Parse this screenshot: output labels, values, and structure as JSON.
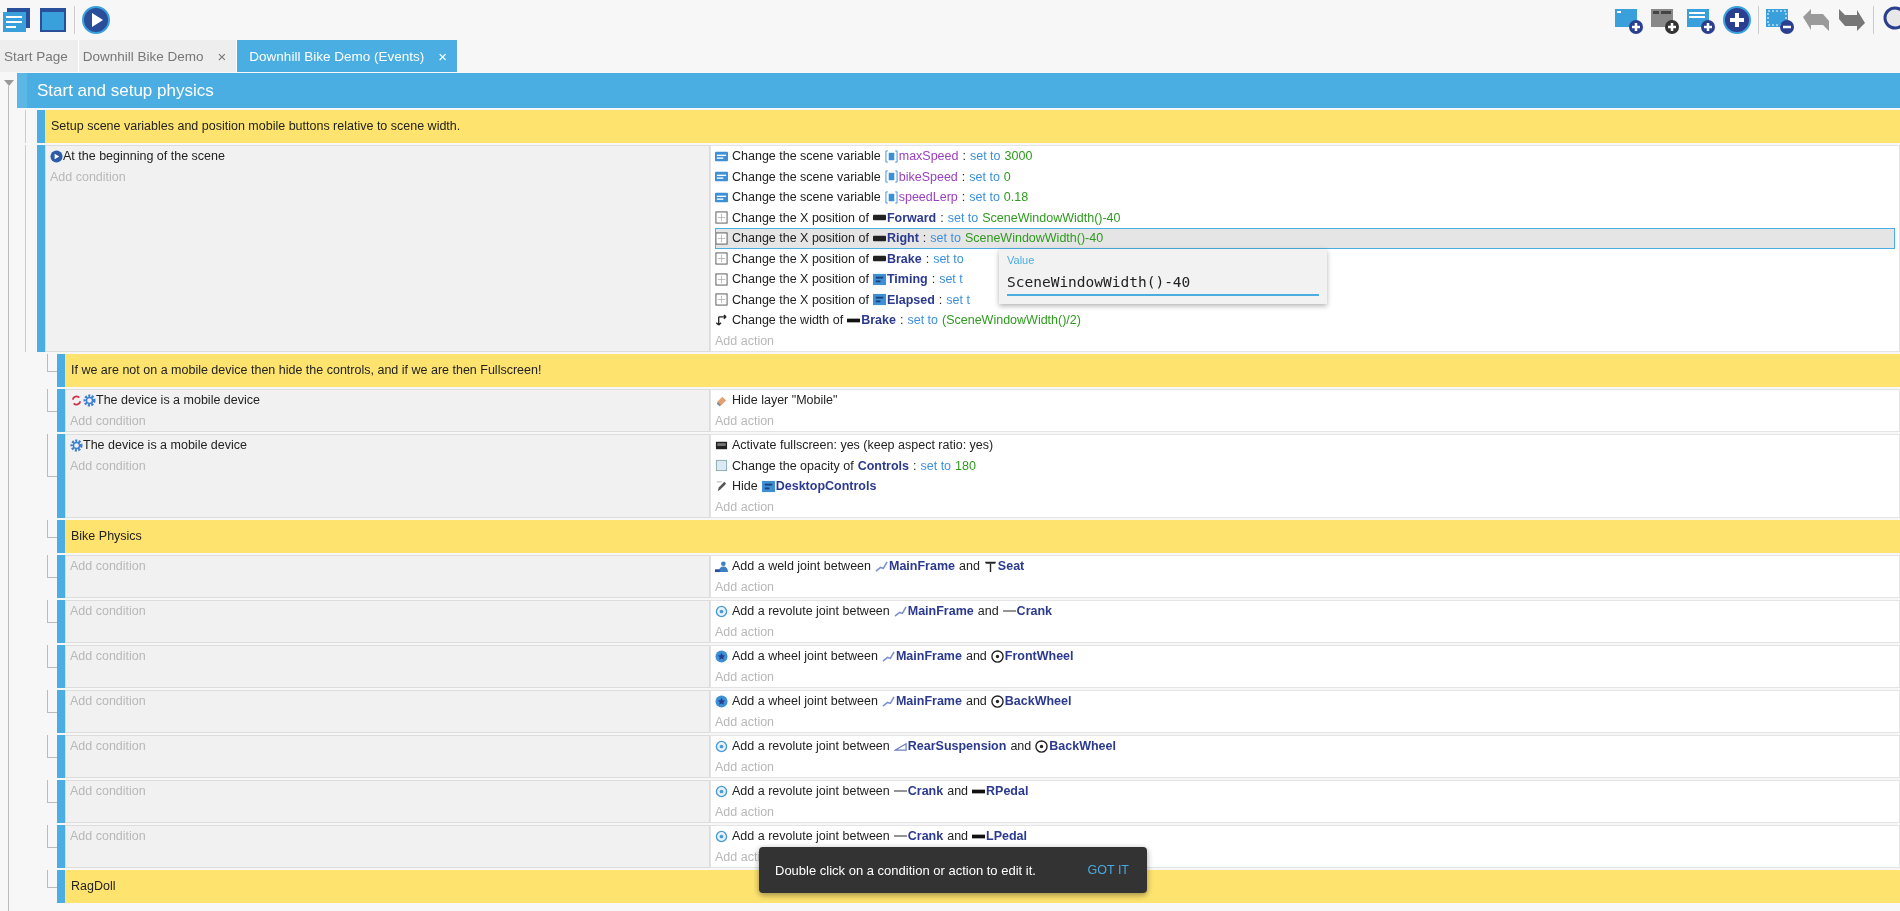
{
  "tabs": [
    {
      "label": "Start Page",
      "selected": false
    },
    {
      "label": "Downhill Bike Demo",
      "selected": false,
      "close": "×"
    },
    {
      "label": "Downhill Bike Demo (Events)",
      "selected": true,
      "close": "×"
    }
  ],
  "group": {
    "title": "Start and setup physics",
    "items": [
      {
        "kind": "comment",
        "text": "Setup scene variables and position mobile buttons relative to scene width."
      },
      {
        "kind": "event",
        "conditions": [
          {
            "kind": "scene-start",
            "inverted": false,
            "text": "At the beginning of the scene"
          }
        ],
        "add_condition": "Add condition",
        "add_action": "Add action",
        "actions": [
          {
            "kind": "variable",
            "selected": false,
            "parts": [
              {
                "kind": "text",
                "text": "Change the scene variable"
              },
              {
                "kind": "var",
                "text": "maxSpeed"
              },
              {
                "kind": "text",
                "text": ":"
              },
              {
                "kind": "op",
                "text": "set to"
              },
              {
                "kind": "value",
                "text": "3000"
              }
            ]
          },
          {
            "kind": "variable",
            "selected": false,
            "parts": [
              {
                "kind": "text",
                "text": "Change the scene variable"
              },
              {
                "kind": "var",
                "text": "bikeSpeed"
              },
              {
                "kind": "text",
                "text": ":"
              },
              {
                "kind": "op",
                "text": "set to"
              },
              {
                "kind": "value",
                "text": "0"
              }
            ]
          },
          {
            "kind": "variable",
            "selected": false,
            "parts": [
              {
                "kind": "text",
                "text": "Change the scene variable"
              },
              {
                "kind": "var",
                "text": "speedLerp"
              },
              {
                "kind": "text",
                "text": ":"
              },
              {
                "kind": "op",
                "text": "set to"
              },
              {
                "kind": "value",
                "text": "0.18"
              }
            ]
          },
          {
            "kind": "position",
            "selected": false,
            "parts": [
              {
                "kind": "text",
                "text": "Change the X position of"
              },
              {
                "kind": "button",
                "text": "Forward"
              },
              {
                "kind": "text",
                "text": ":"
              },
              {
                "kind": "op",
                "text": "set to"
              },
              {
                "kind": "value",
                "text": "SceneWindowWidth()-40"
              }
            ]
          },
          {
            "kind": "position",
            "selected": true,
            "parts": [
              {
                "kind": "text",
                "text": "Change the X position of"
              },
              {
                "kind": "button",
                "text": "Right"
              },
              {
                "kind": "text",
                "text": ":"
              },
              {
                "kind": "op",
                "text": "set to"
              },
              {
                "kind": "value",
                "text": "SceneWindowWidth()-40"
              }
            ],
            "editor": {
              "label": "Value",
              "value": "SceneWindowWidth()-40"
            }
          },
          {
            "kind": "position",
            "selected": false,
            "parts": [
              {
                "kind": "text",
                "text": "Change the X position of"
              },
              {
                "kind": "button",
                "text": "Brake"
              },
              {
                "kind": "text",
                "text": ":"
              },
              {
                "kind": "op",
                "text": "set to"
              }
            ]
          },
          {
            "kind": "position",
            "selected": false,
            "parts": [
              {
                "kind": "text",
                "text": "Change the X position of"
              },
              {
                "kind": "textobject",
                "text": "Timing"
              },
              {
                "kind": "text",
                "text": ":"
              },
              {
                "kind": "op",
                "text": "set t"
              }
            ]
          },
          {
            "kind": "position",
            "selected": false,
            "parts": [
              {
                "kind": "text",
                "text": "Change the X position of"
              },
              {
                "kind": "textobject",
                "text": "Elapsed"
              },
              {
                "kind": "text",
                "text": ":"
              },
              {
                "kind": "op",
                "text": "set t"
              }
            ]
          },
          {
            "kind": "width",
            "selected": false,
            "parts": [
              {
                "kind": "text",
                "text": "Change the width of"
              },
              {
                "kind": "pedal",
                "text": "Brake"
              },
              {
                "kind": "text",
                "text": ":"
              },
              {
                "kind": "op",
                "text": "set to"
              },
              {
                "kind": "value",
                "text": "(SceneWindowWidth()/2)"
              }
            ]
          }
        ],
        "children": [
          {
            "kind": "comment",
            "text": "If we are not on a mobile device then hide the controls, and if we are then Fullscreen!"
          },
          {
            "kind": "event",
            "conditions": [
              {
                "kind": "device",
                "inverted": true,
                "text": "The device is a mobile device"
              }
            ],
            "add_condition": "Add condition",
            "add_action": "Add action",
            "actions": [
              {
                "kind": "layer",
                "selected": false,
                "parts": [
                  {
                    "kind": "text",
                    "text": "Hide layer \"Mobile\""
                  }
                ]
              }
            ]
          },
          {
            "kind": "event",
            "conditions": [
              {
                "kind": "device",
                "inverted": false,
                "text": "The device is a mobile device"
              }
            ],
            "add_condition": "Add condition",
            "add_action": "Add action",
            "actions": [
              {
                "kind": "fullscreen",
                "selected": false,
                "parts": [
                  {
                    "kind": "text",
                    "text": "Activate fullscreen: yes (keep aspect ratio: yes)"
                  }
                ]
              },
              {
                "kind": "opacity",
                "selected": false,
                "parts": [
                  {
                    "kind": "text",
                    "text": "Change the opacity of"
                  },
                  {
                    "kind": "object",
                    "text": "Controls"
                  },
                  {
                    "kind": "text",
                    "text": ":"
                  },
                  {
                    "kind": "op",
                    "text": "set to"
                  },
                  {
                    "kind": "value",
                    "text": "180"
                  }
                ]
              },
              {
                "kind": "visibility",
                "selected": false,
                "parts": [
                  {
                    "kind": "text",
                    "text": "Hide"
                  },
                  {
                    "kind": "textobject",
                    "text": "DesktopControls"
                  }
                ]
              }
            ]
          },
          {
            "kind": "comment",
            "text": "Bike Physics"
          },
          {
            "kind": "event",
            "add_condition": "Add condition",
            "add_action": "Add action",
            "actions": [
              {
                "kind": "weld",
                "selected": false,
                "parts": [
                  {
                    "kind": "text",
                    "text": "Add a weld joint between"
                  },
                  {
                    "kind": "frame",
                    "text": "MainFrame"
                  },
                  {
                    "kind": "text",
                    "text": "and"
                  },
                  {
                    "kind": "seat",
                    "text": "Seat"
                  }
                ]
              }
            ]
          },
          {
            "kind": "event",
            "add_condition": "Add condition",
            "add_action": "Add action",
            "actions": [
              {
                "kind": "revolute",
                "selected": false,
                "parts": [
                  {
                    "kind": "text",
                    "text": "Add a revolute joint between"
                  },
                  {
                    "kind": "frame",
                    "text": "MainFrame"
                  },
                  {
                    "kind": "text",
                    "text": "and"
                  },
                  {
                    "kind": "crank",
                    "text": "Crank"
                  }
                ]
              }
            ]
          },
          {
            "kind": "event",
            "add_condition": "Add condition",
            "add_action": "Add action",
            "actions": [
              {
                "kind": "wheel-joint",
                "selected": false,
                "parts": [
                  {
                    "kind": "text",
                    "text": "Add a wheel joint between"
                  },
                  {
                    "kind": "frame",
                    "text": "MainFrame"
                  },
                  {
                    "kind": "text",
                    "text": "and"
                  },
                  {
                    "kind": "wheel",
                    "text": "FrontWheel"
                  }
                ]
              }
            ]
          },
          {
            "kind": "event",
            "add_condition": "Add condition",
            "add_action": "Add action",
            "actions": [
              {
                "kind": "wheel-joint",
                "selected": false,
                "parts": [
                  {
                    "kind": "text",
                    "text": "Add a wheel joint between"
                  },
                  {
                    "kind": "frame",
                    "text": "MainFrame"
                  },
                  {
                    "kind": "text",
                    "text": "and"
                  },
                  {
                    "kind": "wheel",
                    "text": "BackWheel"
                  }
                ]
              }
            ]
          },
          {
            "kind": "event",
            "add_condition": "Add condition",
            "add_action": "Add action",
            "actions": [
              {
                "kind": "revolute",
                "selected": false,
                "parts": [
                  {
                    "kind": "text",
                    "text": "Add a revolute joint between"
                  },
                  {
                    "kind": "suspension",
                    "text": "RearSuspension"
                  },
                  {
                    "kind": "text",
                    "text": "and"
                  },
                  {
                    "kind": "wheel",
                    "text": "BackWheel"
                  }
                ]
              }
            ]
          },
          {
            "kind": "event",
            "add_condition": "Add condition",
            "add_action": "Add action",
            "actions": [
              {
                "kind": "revolute",
                "selected": false,
                "parts": [
                  {
                    "kind": "text",
                    "text": "Add a revolute joint between"
                  },
                  {
                    "kind": "crank",
                    "text": "Crank"
                  },
                  {
                    "kind": "text",
                    "text": "and"
                  },
                  {
                    "kind": "pedal",
                    "text": "RPedal"
                  }
                ]
              }
            ]
          },
          {
            "kind": "event",
            "add_condition": "Add condition",
            "add_action": "Add acti",
            "actions": [
              {
                "kind": "revolute",
                "selected": false,
                "parts": [
                  {
                    "kind": "text",
                    "text": "Add a revolute joint between"
                  },
                  {
                    "kind": "crank",
                    "text": "Crank"
                  },
                  {
                    "kind": "text",
                    "text": "and"
                  },
                  {
                    "kind": "pedal",
                    "text": "LPedal"
                  }
                ]
              }
            ]
          },
          {
            "kind": "comment",
            "text": "RagDoll"
          }
        ]
      }
    ]
  },
  "toast": {
    "text": "Double click on a condition or action to edit it.",
    "button": "GOT IT"
  }
}
